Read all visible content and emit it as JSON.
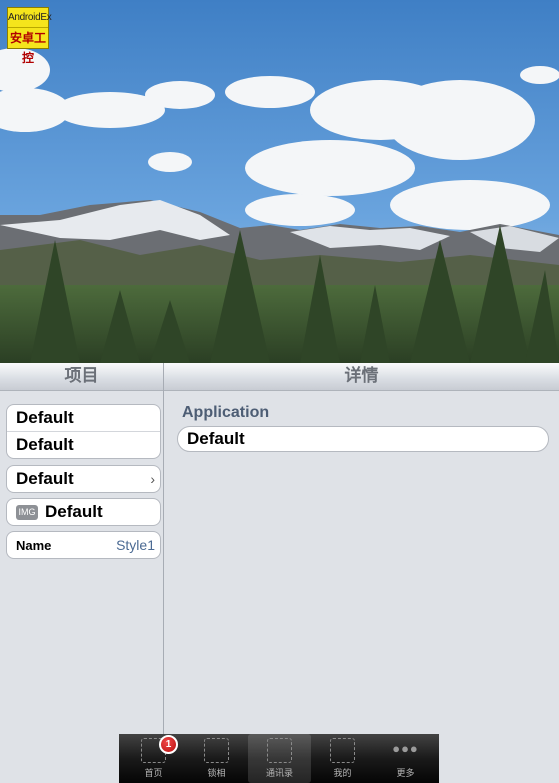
{
  "logo": {
    "line1": "AndroidEx",
    "line2": "安卓工控"
  },
  "master": {
    "header": "项目"
  },
  "detail": {
    "header": "详情",
    "section_title": "Application",
    "field_value": "Default"
  },
  "cells": {
    "group_rows": [
      "Default",
      "Default"
    ],
    "disclosure_row": "Default",
    "image_row": {
      "badge": "IMG",
      "label": "Default"
    },
    "value_row": {
      "label": "Name",
      "value": "Style1"
    }
  },
  "tabbar": {
    "tabs": [
      {
        "label": "首页",
        "badge": "1"
      },
      {
        "label": "锁相"
      },
      {
        "label": "通讯录"
      },
      {
        "label": "我的"
      },
      {
        "label": "更多"
      }
    ],
    "selected_index": 2
  },
  "colors": {
    "badge": "#d11a1a",
    "accent_text": "#4b6a93"
  }
}
